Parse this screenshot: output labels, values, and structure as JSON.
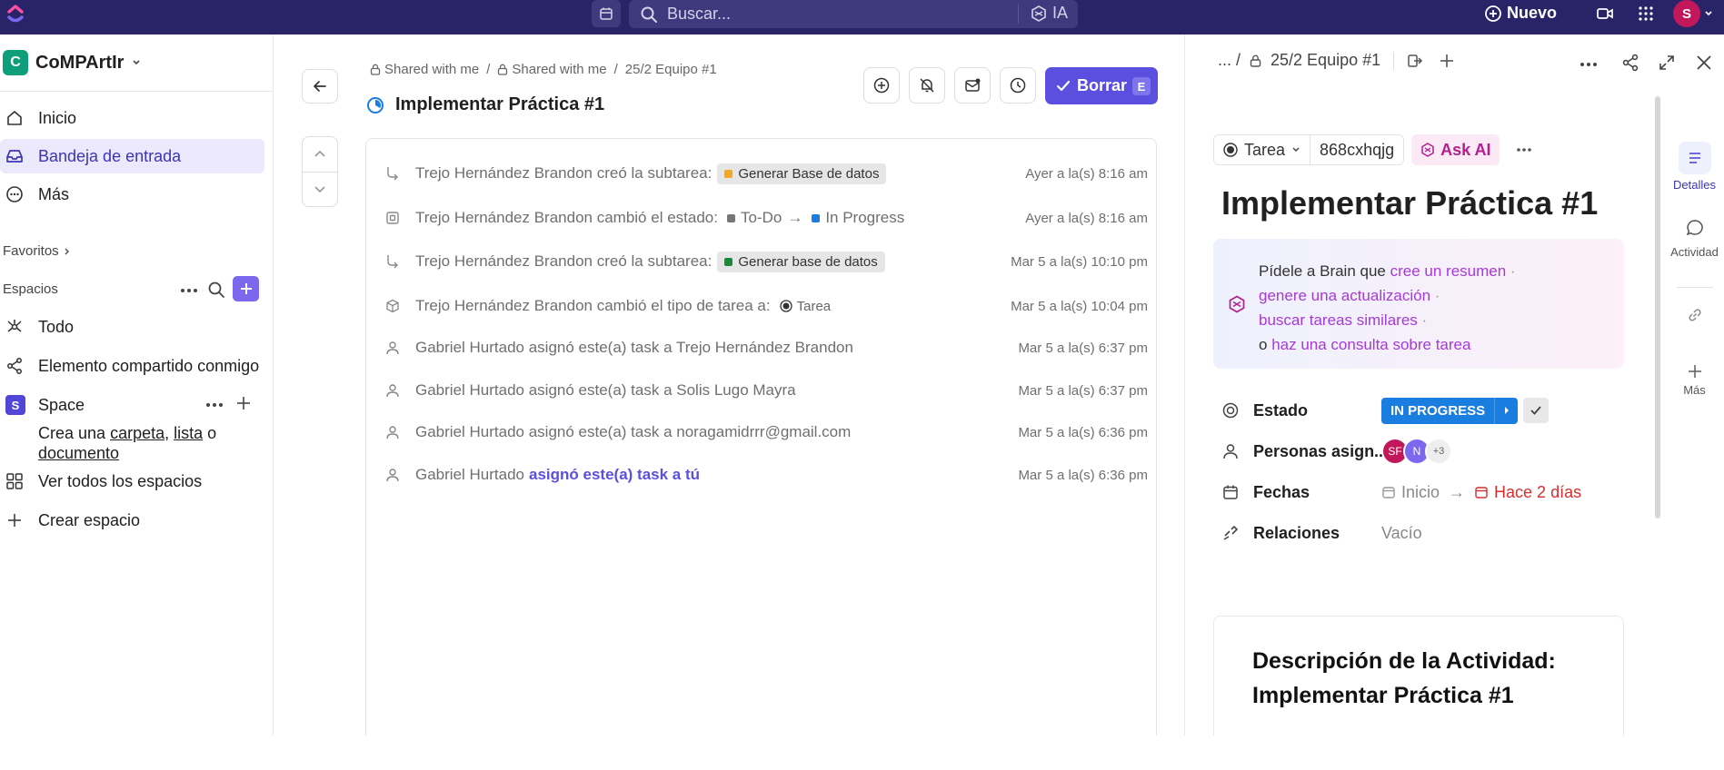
{
  "topbar": {
    "search_placeholder": "Buscar...",
    "ia_label": "IA",
    "new_label": "Nuevo",
    "user_initial": "S"
  },
  "sidebar": {
    "workspace_initial": "C",
    "workspace_name": "CoMPArtIr",
    "nav": [
      {
        "label": "Inicio",
        "icon": "home-icon"
      },
      {
        "label": "Bandeja de entrada",
        "icon": "inbox-icon"
      },
      {
        "label": "Más",
        "icon": "more-icon"
      }
    ],
    "favorites_label": "Favoritos",
    "spaces_label": "Espacios",
    "spaces": [
      {
        "label": "Todo",
        "icon": "hub-icon"
      },
      {
        "label": "Elemento compartido conmigo",
        "icon": "share-icon"
      },
      {
        "label": "Space",
        "initial": "S"
      }
    ],
    "create_prefix": "Crea una",
    "create_carpeta": "carpeta",
    "create_lista": "lista",
    "create_o": "o",
    "create_documento": "documento",
    "view_all_spaces": "Ver todos los espacios",
    "create_space": "Crear espacio"
  },
  "center": {
    "breadcrumb": [
      "Shared with me",
      "Shared with me",
      "25/2 Equipo #1"
    ],
    "task_title": "Implementar Práctica #1",
    "delete_label": "Borrar",
    "delete_key": "E",
    "activity": [
      {
        "text": "Trejo Hernández Brandon creó la subtarea:",
        "chip": "Generar Base de datos",
        "chip_color": "#f5a623",
        "time": "Ayer a la(s) 8:16 am",
        "icon": "subtask-icon"
      },
      {
        "text": "Trejo Hernández Brandon cambió el estado:",
        "from": "To-Do",
        "to": "In Progress",
        "time": "Ayer a la(s) 8:16 am",
        "icon": "status-icon"
      },
      {
        "text": "Trejo Hernández Brandon creó la subtarea:",
        "chip": "Generar base de datos",
        "chip_color": "#1b8a3a",
        "time": "Mar 5 a la(s) 10:10 pm",
        "icon": "subtask-icon"
      },
      {
        "text": "Trejo Hernández Brandon cambió el tipo de tarea a:",
        "type_label": "Tarea",
        "time": "Mar 5 a la(s) 10:04 pm",
        "icon": "cube-icon"
      },
      {
        "text": "Gabriel Hurtado asignó este(a) task a Trejo Hernández Brandon",
        "time": "Mar 5 a la(s) 6:37 pm",
        "icon": "person-icon"
      },
      {
        "text": "Gabriel Hurtado asignó este(a) task a Solis Lugo Mayra",
        "time": "Mar 5 a la(s) 6:37 pm",
        "icon": "person-icon"
      },
      {
        "text": "Gabriel Hurtado asignó este(a) task a noragamidrrr@gmail.com",
        "time": "Mar 5 a la(s) 6:36 pm",
        "icon": "person-icon"
      },
      {
        "text": "Gabriel Hurtado",
        "highlight": "asignó este(a) task a tú",
        "time": "Mar 5 a la(s) 6:36 pm",
        "icon": "person-icon"
      }
    ]
  },
  "right": {
    "breadcrumb_ellipsis": "... /",
    "breadcrumb_label": "25/2 Equipo #1",
    "type_label": "Tarea",
    "task_id": "868cxhqjg",
    "ask_ai": "Ask AI",
    "title": "Implementar Práctica #1",
    "brain": {
      "prefix": "Pídele a Brain que",
      "l1": "cree un resumen",
      "l2": "genere una actualización",
      "l3": "buscar tareas similares",
      "o": "o",
      "l4": "haz una consulta sobre tarea"
    },
    "fields": {
      "estado_label": "Estado",
      "estado_value": "IN PROGRESS",
      "personas_label": "Personas asign...",
      "assignees": [
        {
          "initials": "SF",
          "color": "#c2185b"
        },
        {
          "initials": "N",
          "color": "#7b68ee"
        }
      ],
      "more_assignees": "+3",
      "fechas_label": "Fechas",
      "inicio": "Inicio",
      "due": "Hace 2 días",
      "relaciones_label": "Relaciones",
      "relaciones_value": "Vacío"
    },
    "description_title": "Descripción de la Actividad: Implementar Práctica #1",
    "side_tabs": {
      "detalles": "Detalles",
      "actividad": "Actividad",
      "mas": "Más"
    }
  },
  "colors": {
    "topbar": "#292468",
    "accent": "#5b4fe0",
    "status_blue": "#1a7de0",
    "due_red": "#d32f2f"
  }
}
